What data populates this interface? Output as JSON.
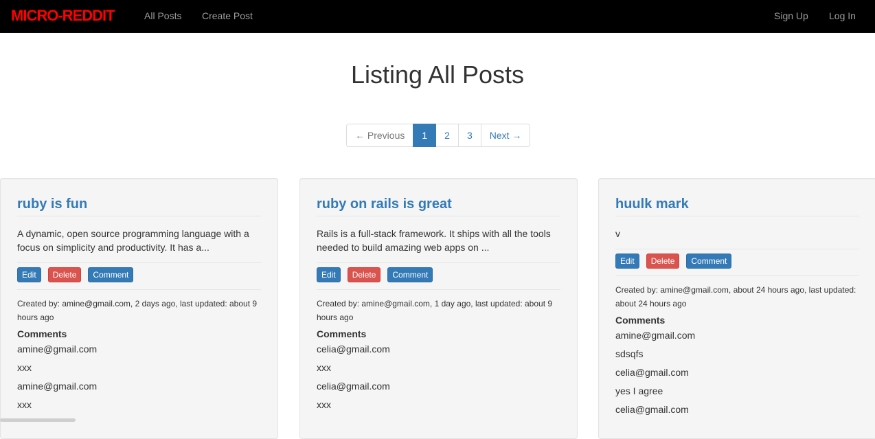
{
  "navbar": {
    "brand": "MICRO-REDDIT",
    "links": {
      "all_posts": "All Posts",
      "create_post": "Create Post",
      "sign_up": "Sign Up",
      "log_in": "Log In"
    },
    "brand_color": "#ff0000",
    "background": "#000000"
  },
  "page": {
    "title": "Listing All Posts"
  },
  "pagination": {
    "previous": "← Previous",
    "pages": [
      "1",
      "2",
      "3"
    ],
    "current": "1",
    "next": "Next →"
  },
  "actions": {
    "edit": "Edit",
    "delete": "Delete",
    "comment": "Comment"
  },
  "comments_heading": "Comments",
  "posts": [
    {
      "title": "ruby is fun",
      "body": "A dynamic, open source programming language with a focus on simplicity and productivity. It has a...",
      "meta": "Created by: amine@gmail.com, 2 days ago, last updated: about 9 hours ago",
      "comments": [
        "amine@gmail.com",
        "xxx",
        "amine@gmail.com",
        "xxx"
      ]
    },
    {
      "title": "ruby on rails is great",
      "body": "Rails is a full-stack framework. It ships with all the tools needed to build amazing web apps on ...",
      "meta": "Created by: amine@gmail.com, 1 day ago, last updated: about 9 hours ago",
      "comments": [
        "celia@gmail.com",
        "xxx",
        "celia@gmail.com",
        "xxx"
      ]
    },
    {
      "title": "huulk mark",
      "body": "v",
      "meta": "Created by: amine@gmail.com, about 24 hours ago, last updated: about 24 hours ago",
      "comments": [
        "amine@gmail.com",
        "sdsqfs",
        "celia@gmail.com",
        "yes I agree",
        "celia@gmail.com"
      ]
    }
  ]
}
